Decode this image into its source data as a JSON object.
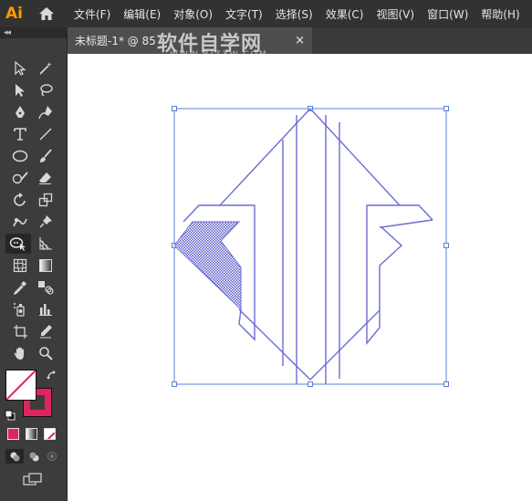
{
  "app": {
    "logo": "Ai"
  },
  "menu": {
    "items": [
      "文件(F)",
      "编辑(E)",
      "对象(O)",
      "文字(T)",
      "选择(S)",
      "效果(C)",
      "视图(V)",
      "窗口(W)",
      "帮助(H)"
    ]
  },
  "toolbar": {
    "collapse_glyph": "◂◂",
    "fill_color": "#ffffff",
    "stroke_color": "#e0245e",
    "selected_tool": "lasso-tool"
  },
  "document": {
    "tab_label": "未标题-1* @ 85",
    "close_glyph": "×"
  },
  "watermark": {
    "title": "软件自学网",
    "url": "WWW.RJZXW.COM"
  },
  "artwork": {
    "line_color": "#6b6bd6",
    "selection_color": "#5a7fd8"
  }
}
